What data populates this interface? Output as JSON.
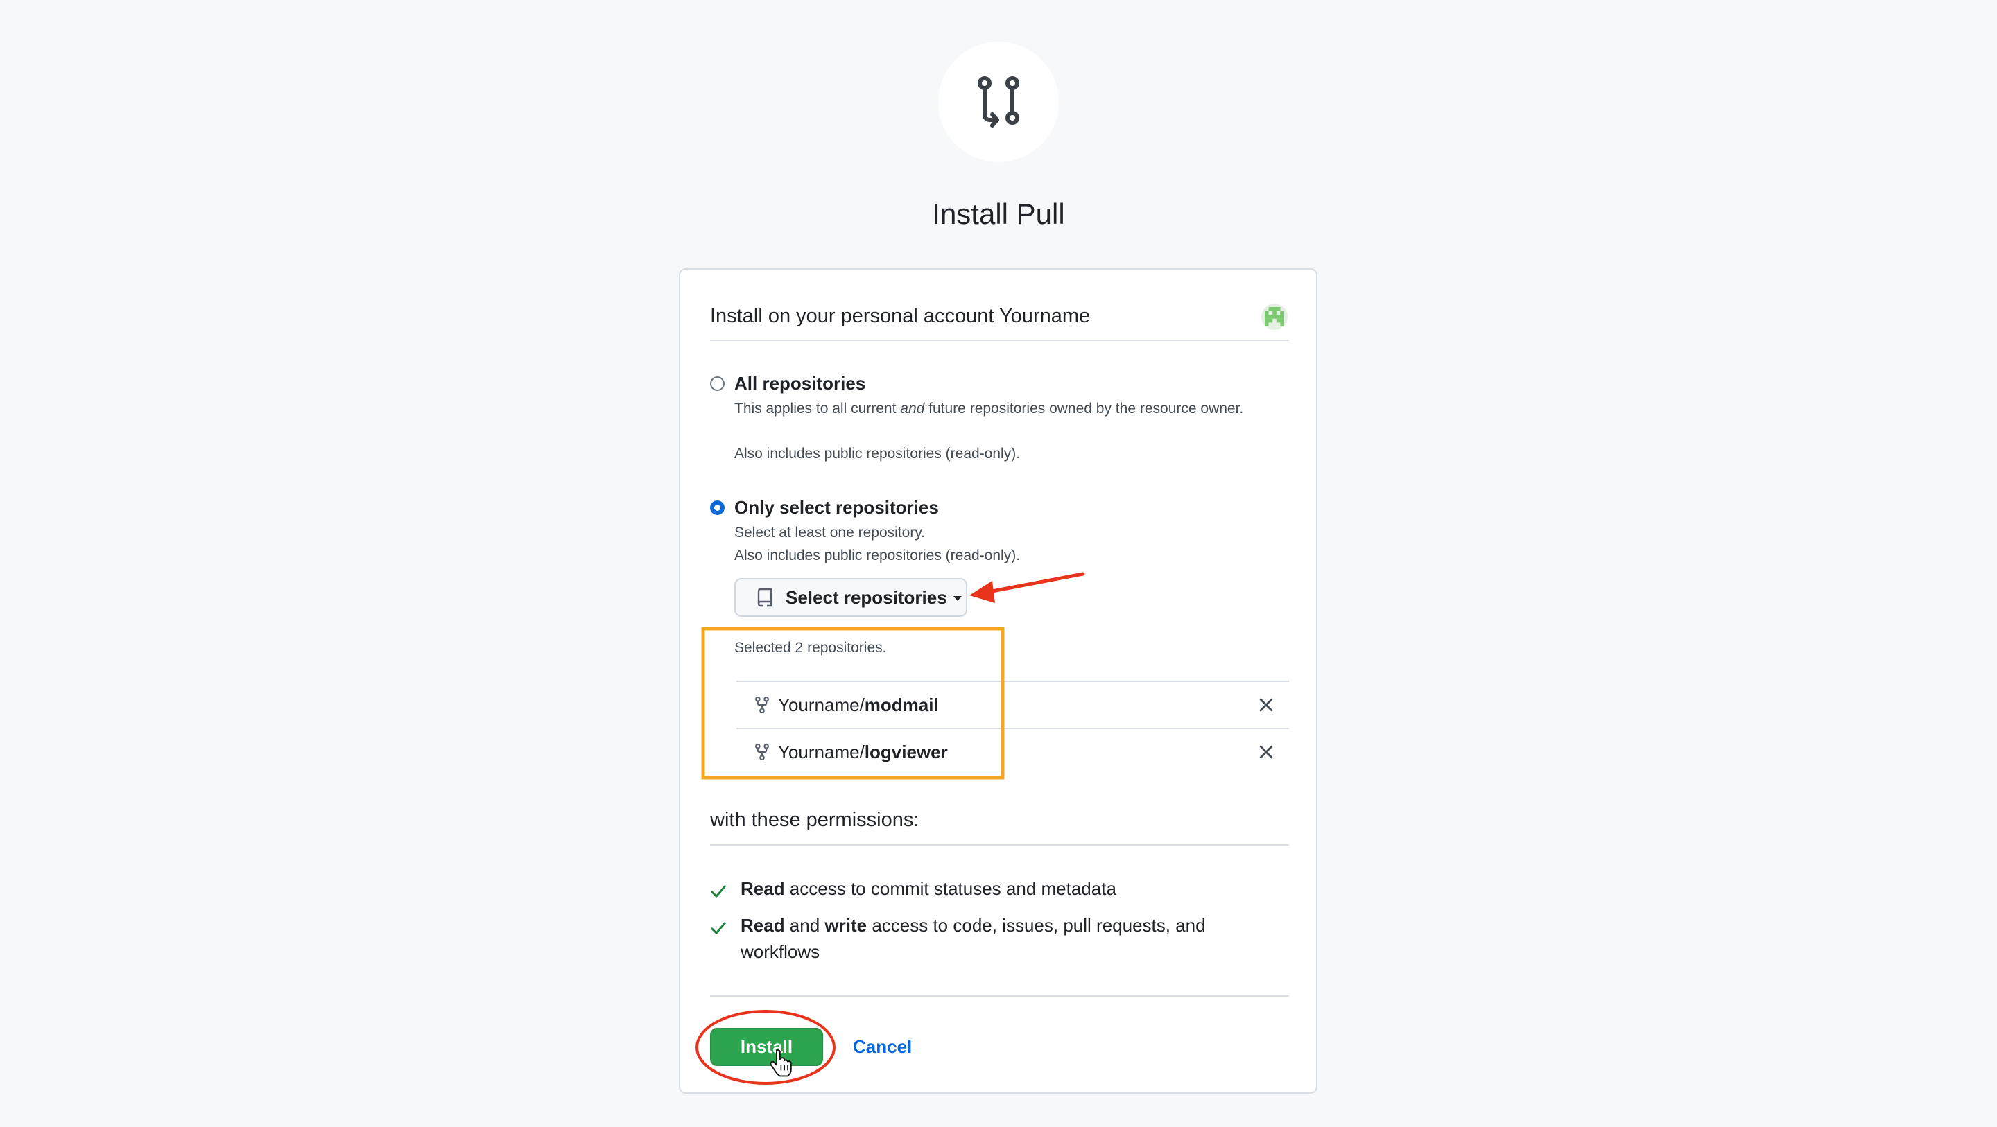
{
  "app": {
    "logo_icon": "git-pull-request-icon",
    "title": "Install Pull"
  },
  "account": {
    "heading": "Install on your personal account Yourname",
    "avatar_icon": "identicon-avatar"
  },
  "options": {
    "all": {
      "label": "All repositories",
      "desc_pre": "This applies to all current ",
      "desc_em": "and",
      "desc_post": " future repositories owned by the resource owner.",
      "note": "Also includes public repositories (read-only).",
      "checked": false
    },
    "select": {
      "label": "Only select repositories",
      "desc": "Select at least one repository.",
      "note": "Also includes public repositories (read-only).",
      "checked": true
    }
  },
  "select_button": {
    "icon": "repo-icon",
    "label": "Select repositories",
    "caret_icon": "caret-down-icon"
  },
  "selection": {
    "count_text": "Selected 2 repositories.",
    "repos": [
      {
        "owner": "Yourname/",
        "name": "modmail"
      },
      {
        "owner": "Yourname/",
        "name": "logviewer"
      }
    ]
  },
  "permissions": {
    "heading": "with these permissions:",
    "items": [
      {
        "b1": "Read",
        "t1": " access to commit statuses and metadata",
        "b2": "",
        "t2": ""
      },
      {
        "b1": "Read",
        "t1": " and ",
        "b2": "write",
        "t2": " access to code, issues, pull requests, and workflows"
      }
    ]
  },
  "actions": {
    "install_label": "Install",
    "cancel_label": "Cancel"
  },
  "colors": {
    "install_green": "#2da44e",
    "link_blue": "#0969da",
    "annotation_red": "#e8341c",
    "annotation_orange": "#f5a524"
  }
}
